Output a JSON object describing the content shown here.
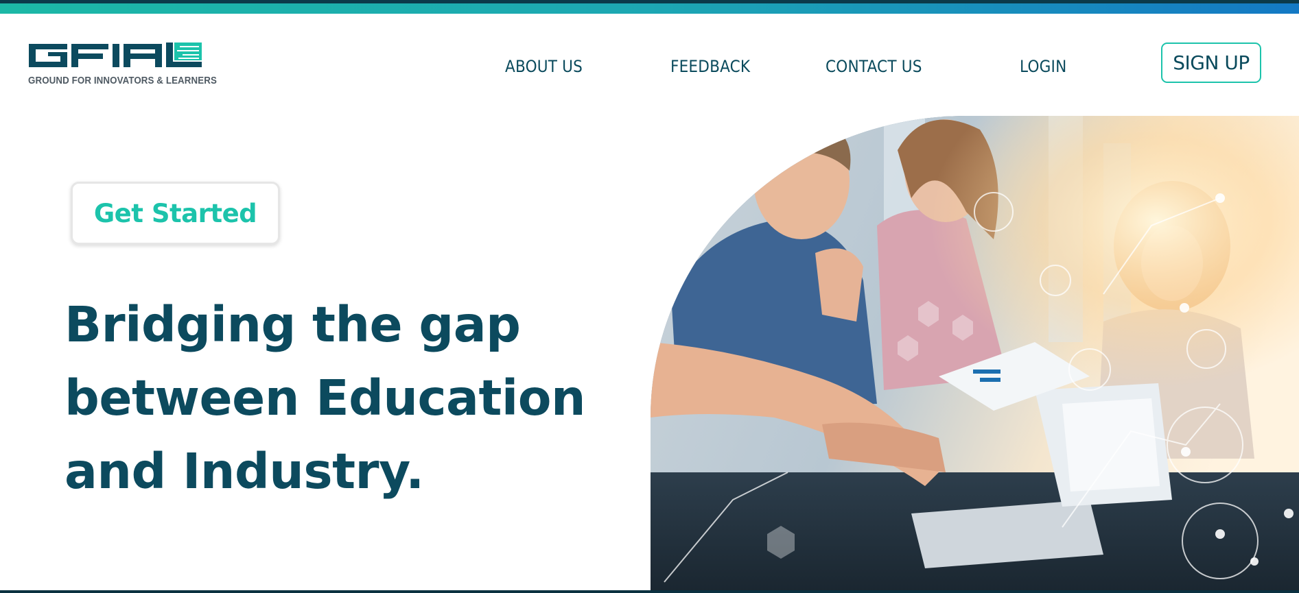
{
  "brand": {
    "logo_text": "GFIAL",
    "tagline": "GROUND FOR INNOVATORS & LEARNERS",
    "colors": {
      "primary": "#0c4a5e",
      "accent": "#1cc3ab",
      "gradient_start": "#1cb8a6",
      "gradient_end": "#1479c4"
    }
  },
  "nav": {
    "items": [
      {
        "label": "ABOUT US"
      },
      {
        "label": "FEEDBACK"
      },
      {
        "label": "CONTACT US"
      },
      {
        "label": "LOGIN"
      }
    ],
    "signup_label": "SIGN UP"
  },
  "hero": {
    "cta_label": "Get Started",
    "title_lines": [
      "Bridging the gap",
      "between Education",
      "and Industry."
    ],
    "image_alt": "team-collaborating-photo"
  }
}
